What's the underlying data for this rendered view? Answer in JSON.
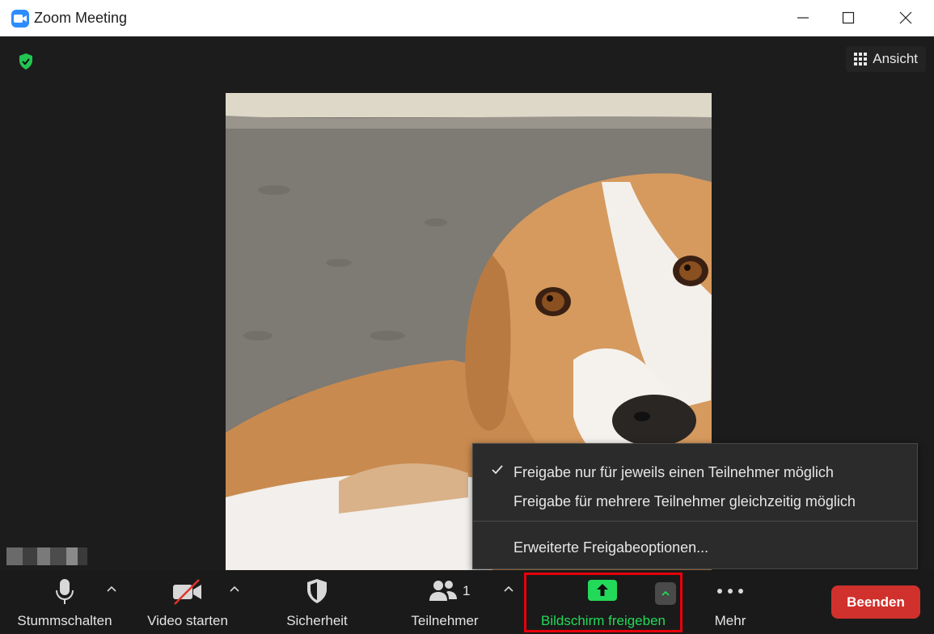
{
  "window": {
    "title": "Zoom Meeting"
  },
  "header": {
    "view_label": "Ansicht"
  },
  "share_menu": {
    "option_single": "Freigabe nur für jeweils einen Teilnehmer möglich",
    "option_multi": "Freigabe für mehrere Teilnehmer gleichzeitig möglich",
    "advanced": "Erweiterte Freigabeoptionen..."
  },
  "toolbar": {
    "mute_label": "Stummschalten",
    "video_label": "Video starten",
    "security_label": "Sicherheit",
    "participants_label": "Teilnehmer",
    "participants_count": "1",
    "share_label": "Bildschirm freigeben",
    "more_label": "Mehr",
    "end_label": "Beenden"
  },
  "colors": {
    "accent_green": "#23d959",
    "end_red": "#d0312d",
    "highlight_red": "#e8000b",
    "zoom_blue": "#2d8cff"
  }
}
